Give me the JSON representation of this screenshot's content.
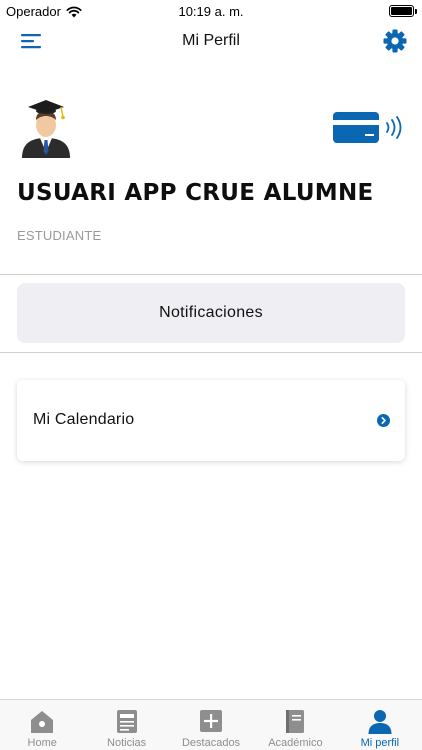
{
  "status_bar": {
    "carrier": "Operador",
    "time": "10:19 a. m."
  },
  "nav": {
    "title": "Mi Perfil"
  },
  "profile": {
    "name": "USUARI APP CRUE ALUMNE",
    "role": "ESTUDIANTE"
  },
  "buttons": {
    "notifications": "Notificaciones"
  },
  "calendar": {
    "label": "Mi Calendario"
  },
  "tabs": [
    {
      "label": "Home",
      "icon": "home-icon",
      "active": false
    },
    {
      "label": "Noticias",
      "icon": "newspaper-icon",
      "active": false
    },
    {
      "label": "Destacados",
      "icon": "plus-square-icon",
      "active": false
    },
    {
      "label": "Académico",
      "icon": "book-icon",
      "active": false
    },
    {
      "label": "Mi perfil",
      "icon": "person-icon",
      "active": true
    }
  ],
  "colors": {
    "accent": "#0b67b2",
    "inactive": "#8e8e8e",
    "button_bg": "#eeeef3"
  }
}
